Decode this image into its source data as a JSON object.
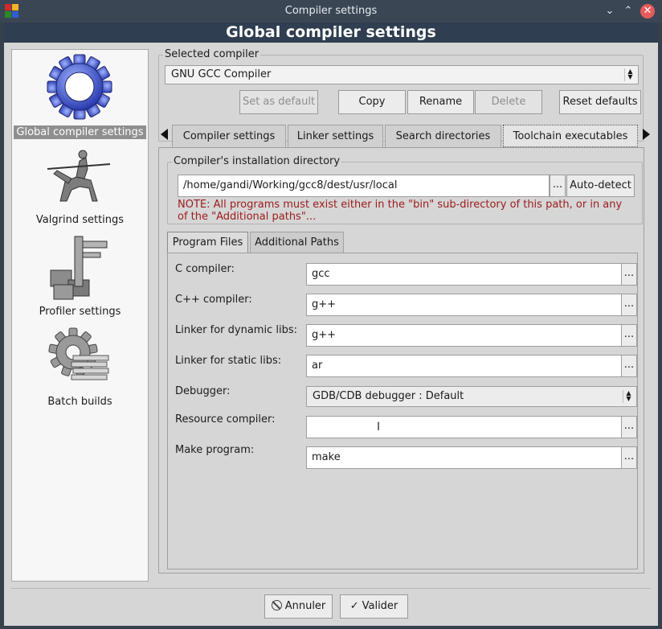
{
  "window": {
    "title": "Compiler settings",
    "header": "Global compiler settings",
    "accent_title_bar": "#3b4654",
    "accent_header": "#2f3e50"
  },
  "sidebar": {
    "items": [
      {
        "label": "Global compiler settings",
        "icon": "gear-icon",
        "selected": true
      },
      {
        "label": "Valgrind settings",
        "icon": "knight-on-horse-icon",
        "selected": false
      },
      {
        "label": "Profiler settings",
        "icon": "caliper-icon",
        "selected": false
      },
      {
        "label": "Batch builds",
        "icon": "gear-stack-icon",
        "selected": false
      }
    ]
  },
  "compiler": {
    "group_title": "Selected compiler",
    "selected": "GNU GCC Compiler",
    "buttons": {
      "set_default": "Set as default",
      "copy": "Copy",
      "rename": "Rename",
      "delete": "Delete",
      "reset": "Reset defaults"
    }
  },
  "tabs": [
    {
      "label": "Compiler settings"
    },
    {
      "label": "Linker settings"
    },
    {
      "label": "Search directories"
    },
    {
      "label": "Toolchain executables",
      "active": true
    }
  ],
  "install": {
    "group_title": "Compiler's installation directory",
    "path": "/home/gandi/Working/gcc8/dest/usr/local",
    "browse": "...",
    "autodetect": "Auto-detect",
    "note_line1": "NOTE: All programs must exist either in the \"bin\" sub-directory of this path, or in any",
    "note_line2": "of the \"Additional paths\"..."
  },
  "subtabs": [
    {
      "label": "Program Files",
      "active": true
    },
    {
      "label": "Additional Paths"
    }
  ],
  "programs": {
    "c_label": "C compiler:",
    "c_value": "gcc",
    "cpp_label": "C++ compiler:",
    "cpp_value": "g++",
    "dyn_label": "Linker for dynamic libs:",
    "dyn_value": "g++",
    "static_label": "Linker for static libs:",
    "static_value": "ar",
    "debugger_label": "Debugger:",
    "debugger_value": "GDB/CDB debugger : Default",
    "res_label": "Resource compiler:",
    "res_value": "",
    "make_label": "Make program:",
    "make_value": "make",
    "browse": "..."
  },
  "footer": {
    "cancel": "Annuler",
    "ok": "Valider"
  }
}
